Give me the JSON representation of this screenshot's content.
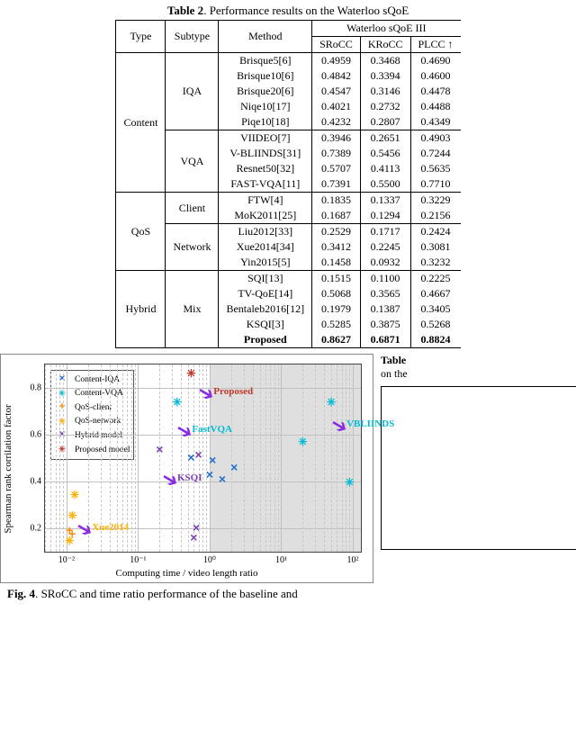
{
  "table2": {
    "caption_prefix": "Table 2",
    "caption_rest": ". Performance results on the Waterloo sQoE",
    "head_type": "Type",
    "head_subtype": "Subtype",
    "head_method": "Method",
    "head_group": "Waterloo sQoE III",
    "head_srocc": "SRoCC",
    "head_krocc": "KRoCC",
    "head_plcc": "PLCC ↑",
    "groups": [
      {
        "type": "Content",
        "subtypes": [
          {
            "name": "IQA",
            "rows": [
              {
                "m": "Brisque5[6]",
                "s": "0.4959",
                "k": "0.3468",
                "p": "0.4690"
              },
              {
                "m": "Brisque10[6]",
                "s": "0.4842",
                "k": "0.3394",
                "p": "0.4600"
              },
              {
                "m": "Brisque20[6]",
                "s": "0.4547",
                "k": "0.3146",
                "p": "0.4478"
              },
              {
                "m": "Niqe10[17]",
                "s": "0.4021",
                "k": "0.2732",
                "p": "0.4488"
              },
              {
                "m": "Piqe10[18]",
                "s": "0.4232",
                "k": "0.2807",
                "p": "0.4349"
              }
            ]
          },
          {
            "name": "VQA",
            "rows": [
              {
                "m": "VIIDEO[7]",
                "s": "0.3946",
                "k": "0.2651",
                "p": "0.4903"
              },
              {
                "m": "V-BLIINDS[31]",
                "s": "0.7389",
                "k": "0.5456",
                "p": "0.7244"
              },
              {
                "m": "Resnet50[32]",
                "s": "0.5707",
                "k": "0.4113",
                "p": "0.5635"
              },
              {
                "m": "FAST-VQA[11]",
                "s": "0.7391",
                "k": "0.5500",
                "p": "0.7710"
              }
            ]
          }
        ]
      },
      {
        "type": "QoS",
        "subtypes": [
          {
            "name": "Client",
            "rows": [
              {
                "m": "FTW[4]",
                "s": "0.1835",
                "k": "0.1337",
                "p": "0.3229"
              },
              {
                "m": "MoK2011[25]",
                "s": "0.1687",
                "k": "0.1294",
                "p": "0.2156"
              }
            ]
          },
          {
            "name": "Network",
            "rows": [
              {
                "m": "Liu2012[33]",
                "s": "0.2529",
                "k": "0.1717",
                "p": "0.2424"
              },
              {
                "m": "Xue2014[34]",
                "s": "0.3412",
                "k": "0.2245",
                "p": "0.3081"
              },
              {
                "m": "Yin2015[5]",
                "s": "0.1458",
                "k": "0.0932",
                "p": "0.3232"
              }
            ]
          }
        ]
      },
      {
        "type": "Hybrid",
        "subtypes": [
          {
            "name": "Mix",
            "rows": [
              {
                "m": "SQI[13]",
                "s": "0.1515",
                "k": "0.1100",
                "p": "0.2225"
              },
              {
                "m": "TV-QoE[14]",
                "s": "0.5068",
                "k": "0.3565",
                "p": "0.4667"
              },
              {
                "m": "Bentaleb2016[12]",
                "s": "0.1979",
                "k": "0.1387",
                "p": "0.3405"
              },
              {
                "m": "KSQI[3]",
                "s": "0.5285",
                "k": "0.3875",
                "p": "0.5268"
              },
              {
                "m": "Proposed",
                "s": "0.8627",
                "k": "0.6871",
                "p": "0.8824",
                "bold": true
              }
            ]
          }
        ]
      }
    ]
  },
  "chart_data": {
    "type": "scatter",
    "title": "",
    "xlabel": "Computing time / video length ratio",
    "ylabel": "Spearman rank corrilation factor",
    "xscale": "log",
    "xlim": [
      0.005,
      130
    ],
    "ylim": [
      0.1,
      0.9
    ],
    "xticks": [
      0.01,
      0.1,
      1,
      10,
      100
    ],
    "xtick_labels": [
      "10⁻²",
      "10⁻¹",
      "10⁰",
      "10¹",
      "10²"
    ],
    "yticks": [
      0.2,
      0.4,
      0.6,
      0.8
    ],
    "shaded_region_x": [
      1,
      130
    ],
    "legend_position": "upper left",
    "series": [
      {
        "name": "Content-IQA",
        "marker": "x",
        "color": "#1f6fd0",
        "points": [
          {
            "x": 0.55,
            "y": 0.496
          },
          {
            "x": 1.1,
            "y": 0.484
          },
          {
            "x": 2.2,
            "y": 0.455
          },
          {
            "x": 1.5,
            "y": 0.402
          },
          {
            "x": 1.0,
            "y": 0.423
          }
        ]
      },
      {
        "name": "Content-VQA",
        "marker": "*",
        "color": "#00bcd4",
        "points": [
          {
            "x": 50,
            "y": 0.739
          },
          {
            "x": 0.35,
            "y": 0.739
          },
          {
            "x": 20,
            "y": 0.571
          },
          {
            "x": 90,
            "y": 0.395
          }
        ]
      },
      {
        "name": "QoS-client",
        "marker": "+",
        "color": "#ff8c00",
        "points": [
          {
            "x": 0.011,
            "y": 0.184
          },
          {
            "x": 0.012,
            "y": 0.169
          }
        ]
      },
      {
        "name": "QoS-network",
        "marker": "*",
        "color": "#ffb000",
        "points": [
          {
            "x": 0.012,
            "y": 0.253
          },
          {
            "x": 0.013,
            "y": 0.341
          },
          {
            "x": 0.011,
            "y": 0.146
          }
        ]
      },
      {
        "name": "Hybrid model",
        "marker": "x",
        "color": "#7a3fb0",
        "points": [
          {
            "x": 0.6,
            "y": 0.152
          },
          {
            "x": 0.7,
            "y": 0.507
          },
          {
            "x": 0.65,
            "y": 0.198
          },
          {
            "x": 0.2,
            "y": 0.529
          }
        ]
      },
      {
        "name": "Proposed model",
        "marker": "*",
        "color": "#c0392b",
        "points": [
          {
            "x": 0.55,
            "y": 0.863
          }
        ]
      }
    ],
    "annotations": [
      {
        "label": "Proposed",
        "x": 0.9,
        "y": 0.8,
        "color": "#c0392b"
      },
      {
        "label": "FastVQA",
        "x": 0.45,
        "y": 0.64,
        "color": "#00bcd4"
      },
      {
        "label": "VBLIINDS",
        "x": 65,
        "y": 0.66,
        "color": "#00bcd4"
      },
      {
        "label": "KSQI",
        "x": 0.28,
        "y": 0.43,
        "color": "#7a3fb0"
      },
      {
        "label": "Xue2014",
        "x": 0.018,
        "y": 0.22,
        "color": "#ffb000"
      }
    ]
  },
  "side": {
    "table3_prefix": "Table ",
    "table3_line2": "on the "
  },
  "fig4": {
    "prefix": "Fig. 4",
    "rest": ". SRoCC and time ratio performance of the baseline and"
  }
}
